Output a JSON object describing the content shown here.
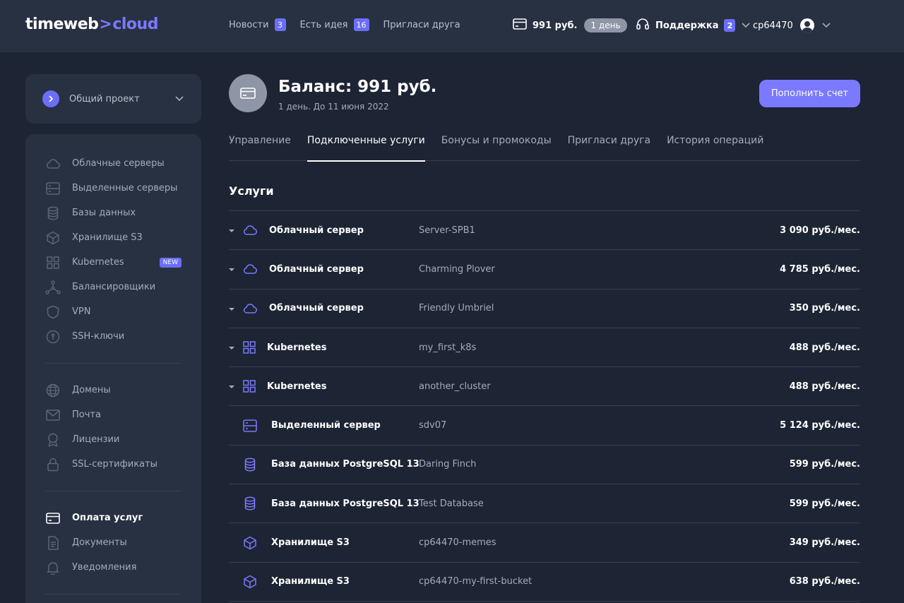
{
  "brand": {
    "part1": "timeweb",
    "sep": ">",
    "part2": "cloud"
  },
  "topnav": [
    {
      "label": "Новости",
      "badge": "3"
    },
    {
      "label": "Есть идея",
      "badge": "16"
    },
    {
      "label": "Пригласи друга",
      "badge": null
    }
  ],
  "topbar": {
    "balance": "991 руб.",
    "days": "1 день",
    "support_label": "Поддержка",
    "support_badge": "2",
    "username": "cp64470"
  },
  "project": {
    "label": "Общий проект"
  },
  "sidebar": {
    "group1": [
      {
        "icon": "cloud-icon",
        "label": "Облачные серверы"
      },
      {
        "icon": "server-icon",
        "label": "Выделенные серверы"
      },
      {
        "icon": "database-icon",
        "label": "Базы данных"
      },
      {
        "icon": "cube-icon",
        "label": "Хранилище S3"
      },
      {
        "icon": "grid-icon",
        "label": "Kubernetes",
        "badge": "NEW"
      },
      {
        "icon": "network-icon",
        "label": "Балансировщики"
      },
      {
        "icon": "shield-icon",
        "label": "VPN"
      },
      {
        "icon": "key-icon",
        "label": "SSH-ключи"
      }
    ],
    "group2": [
      {
        "icon": "globe-icon",
        "label": "Домены"
      },
      {
        "icon": "mail-icon",
        "label": "Почта"
      },
      {
        "icon": "award-icon",
        "label": "Лицензии"
      },
      {
        "icon": "lock-icon",
        "label": "SSL-сертификаты"
      }
    ],
    "group3": [
      {
        "icon": "card-icon",
        "label": "Оплата услуг",
        "active": true
      },
      {
        "icon": "document-icon",
        "label": "Документы"
      },
      {
        "icon": "bell-icon",
        "label": "Уведомления"
      }
    ]
  },
  "balance": {
    "title": "Баланс: 991 руб.",
    "subtitle": "1 день. До 11 июня 2022",
    "topup_label": "Пополнить счет"
  },
  "tabs": [
    {
      "label": "Управление",
      "active": false
    },
    {
      "label": "Подключенные услуги",
      "active": true
    },
    {
      "label": "Бонусы и промокоды",
      "active": false
    },
    {
      "label": "Пригласи друга",
      "active": false
    },
    {
      "label": "История операций",
      "active": false
    }
  ],
  "services_title": "Услуги",
  "services": [
    {
      "icon": "cloud-icon",
      "name": "Облачный сервер",
      "id": "Server-SPB1",
      "price": "3 090 руб./мес.",
      "expandable": true
    },
    {
      "icon": "cloud-icon",
      "name": "Облачный сервер",
      "id": "Charming Plover",
      "price": "4 785 руб./мес.",
      "expandable": true
    },
    {
      "icon": "cloud-icon",
      "name": "Облачный сервер",
      "id": "Friendly Umbriel",
      "price": "350 руб./мес.",
      "expandable": true
    },
    {
      "icon": "grid-icon",
      "name": "Kubernetes",
      "id": "my_first_k8s",
      "price": "488 руб./мес.",
      "expandable": true
    },
    {
      "icon": "grid-icon",
      "name": "Kubernetes",
      "id": "another_cluster",
      "price": "488 руб./мес.",
      "expandable": true
    },
    {
      "icon": "server-icon",
      "name": "Выделенный сервер",
      "id": "sdv07",
      "price": "5 124 руб./мес.",
      "expandable": false
    },
    {
      "icon": "database-icon",
      "name": "База данных PostgreSQL 13",
      "id": "Daring Finch",
      "price": "599 руб./мес.",
      "expandable": false
    },
    {
      "icon": "database-icon",
      "name": "База данных PostgreSQL 13",
      "id": "Test Database",
      "price": "599 руб./мес.",
      "expandable": false
    },
    {
      "icon": "cube-icon",
      "name": "Хранилище S3",
      "id": "cp64470-memes",
      "price": "349 руб./мес.",
      "expandable": false
    },
    {
      "icon": "cube-icon",
      "name": "Хранилище S3",
      "id": "cp64470-my-first-bucket",
      "price": "638 руб./мес.",
      "expandable": false
    }
  ],
  "colors": {
    "accent": "#7b79ff",
    "background": "#1d2433",
    "panel": "#283142"
  }
}
